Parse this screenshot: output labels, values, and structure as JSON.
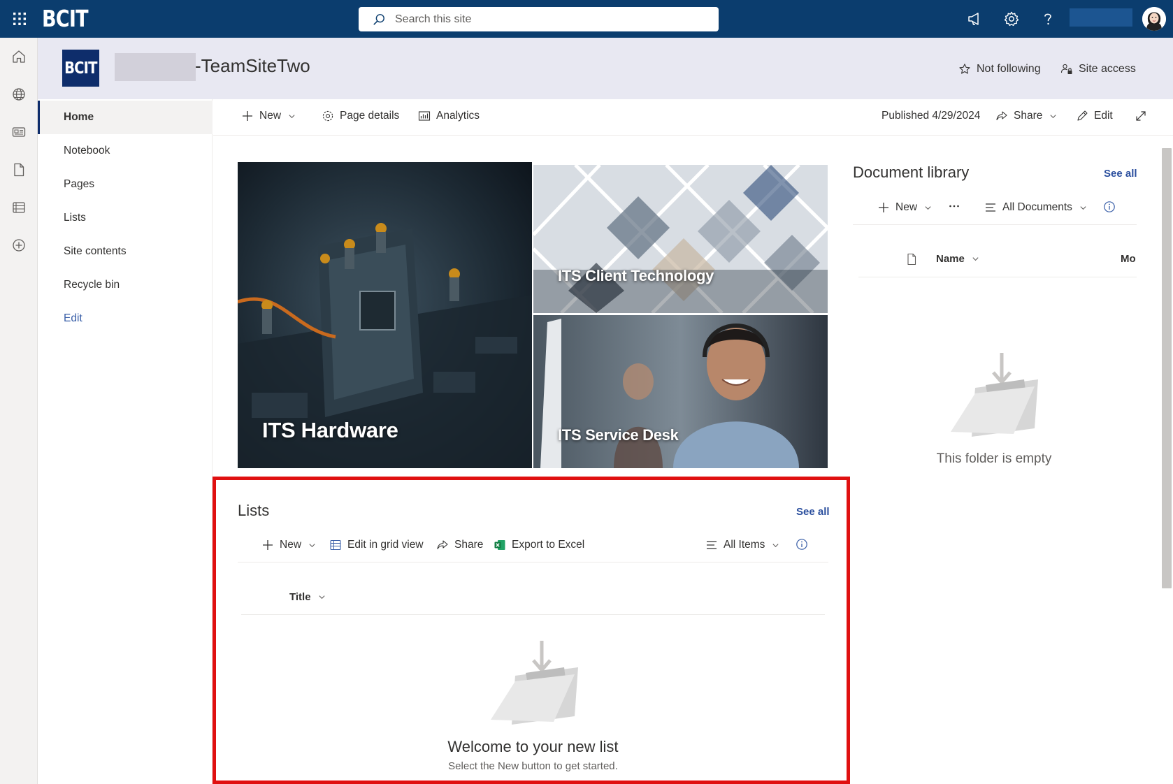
{
  "suite": {
    "brand": "BCIT",
    "search_placeholder": "Search this site"
  },
  "site": {
    "logo_text": "BCIT",
    "title_suffix": "-TeamSiteTwo",
    "follow_label": "Not following",
    "access_label": "Site access"
  },
  "nav": {
    "items": [
      {
        "label": "Home"
      },
      {
        "label": "Notebook"
      },
      {
        "label": "Pages"
      },
      {
        "label": "Lists"
      },
      {
        "label": "Site contents"
      },
      {
        "label": "Recycle bin"
      },
      {
        "label": "Edit"
      }
    ]
  },
  "commandbar": {
    "new_label": "New",
    "page_details_label": "Page details",
    "analytics_label": "Analytics",
    "published_label": "Published 4/29/2024",
    "share_label": "Share",
    "edit_label": "Edit"
  },
  "hero": {
    "tiles": [
      {
        "caption": "ITS Hardware"
      },
      {
        "caption": "ITS Client Technology"
      },
      {
        "caption": "ITS Service Desk"
      }
    ]
  },
  "doclib": {
    "title": "Document library",
    "see_all": "See all",
    "new_label": "New",
    "view_label": "All Documents",
    "col_name": "Name",
    "col_modified": "Mo",
    "empty_text": "This folder is empty"
  },
  "lists": {
    "title": "Lists",
    "see_all": "See all",
    "new_label": "New",
    "grid_label": "Edit in grid view",
    "share_label": "Share",
    "export_label": "Export to Excel",
    "view_label": "All Items",
    "col_title": "Title",
    "welcome": "Welcome to your new list",
    "welcome_sub": "Select the New button to get started."
  },
  "colors": {
    "suitebar": "#0b3d6e",
    "site_logo": "#0e2d6b",
    "link": "#2b4f9e",
    "highlight": "#e01010"
  }
}
